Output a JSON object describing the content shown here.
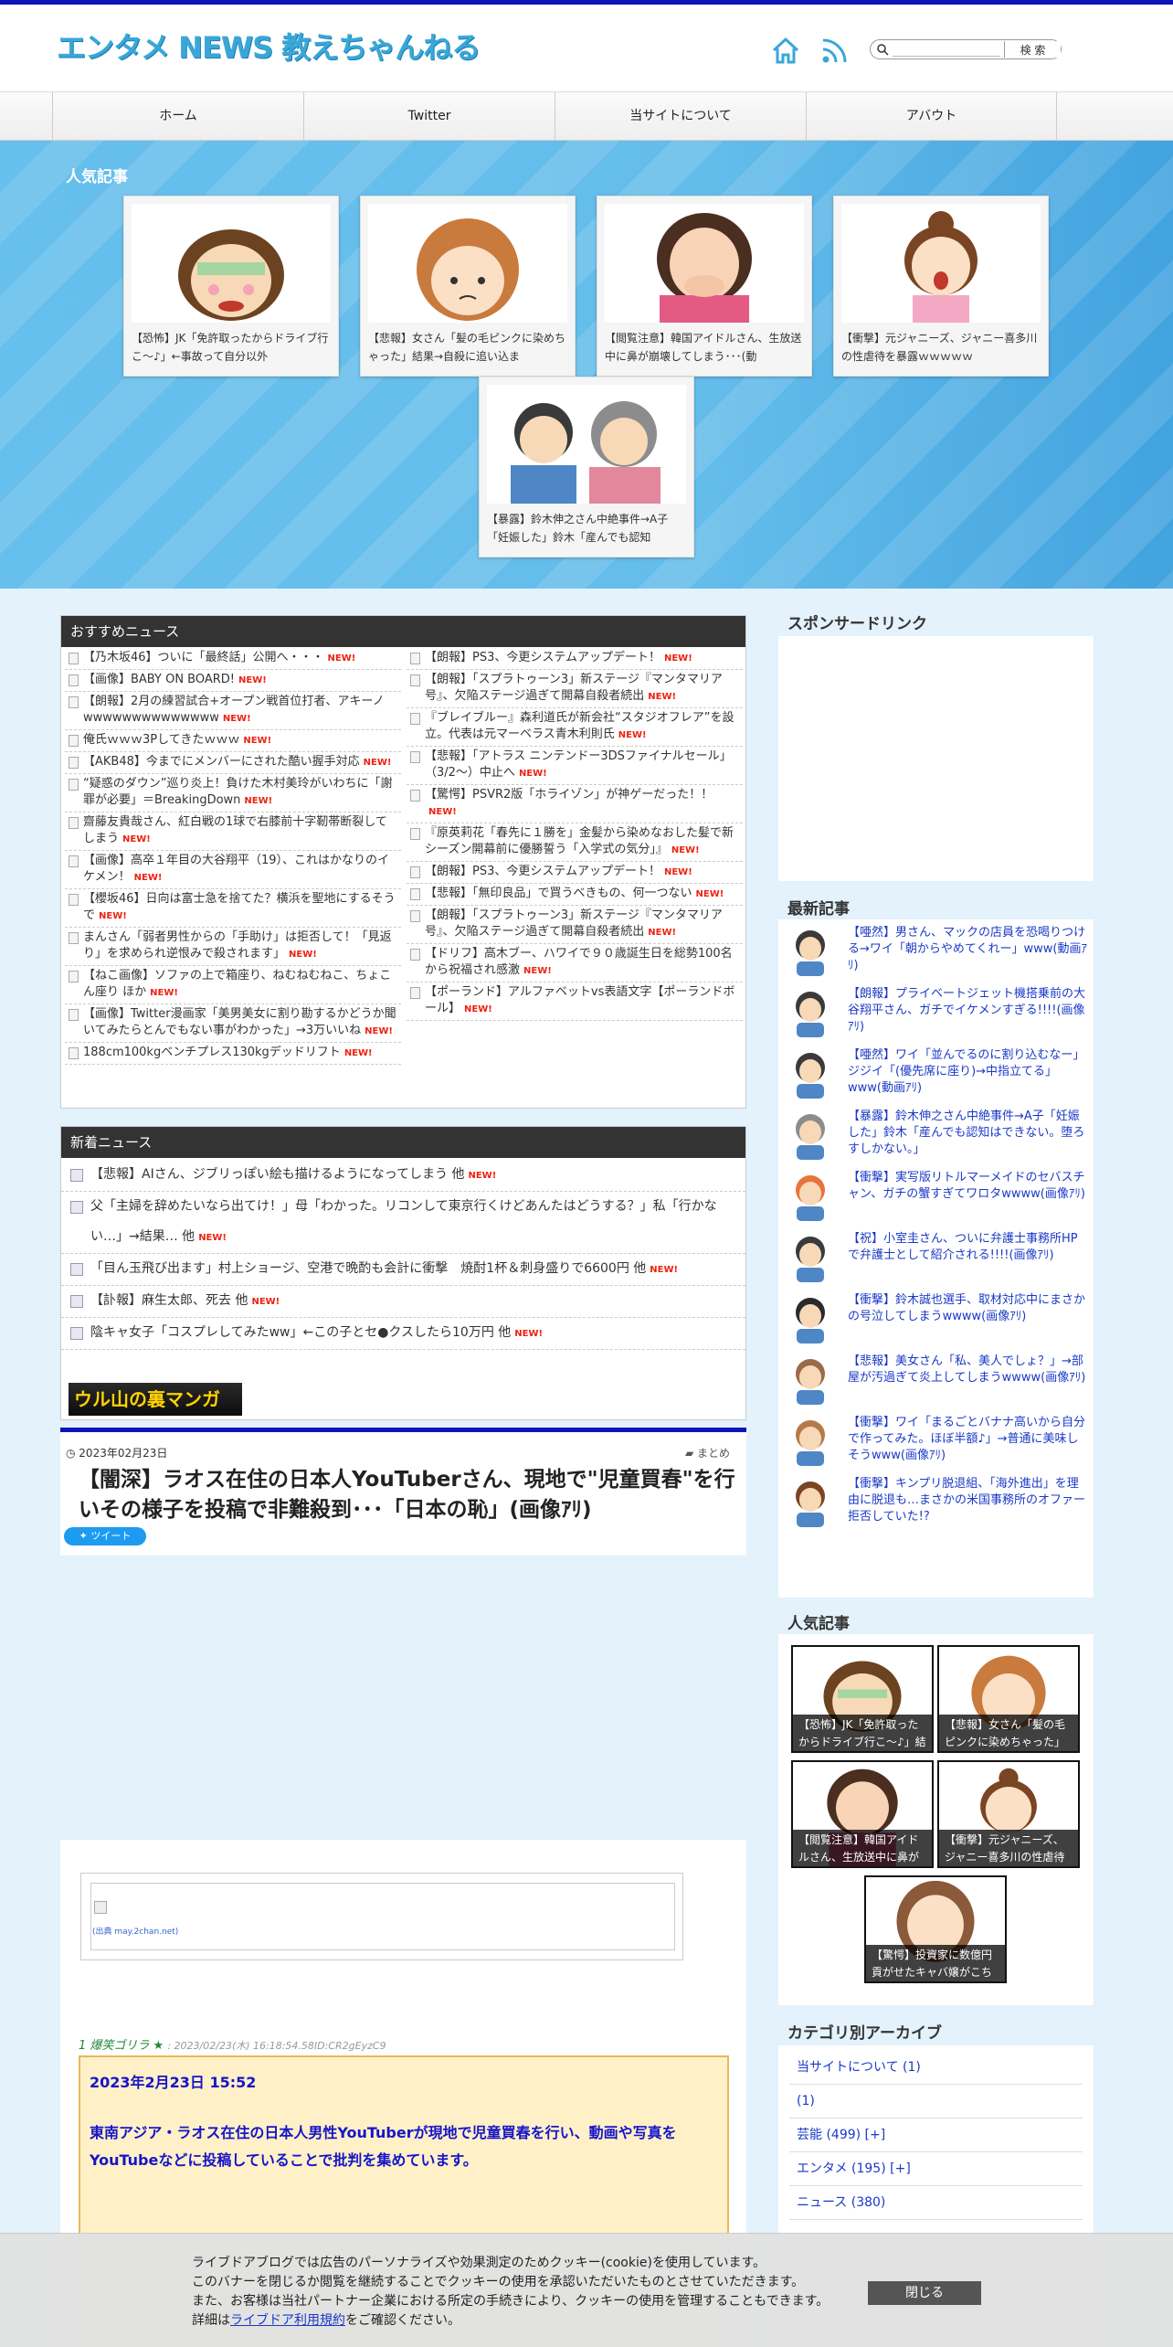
{
  "site": {
    "logo": "エンタメ NEWS 教えちゃんねる",
    "accent": "#0d14b8",
    "hero_blue": "#4ab1e6"
  },
  "header": {
    "home_icon": "home-icon",
    "rss_icon": "rss-icon",
    "search_placeholder": "",
    "search_button": "検 索"
  },
  "nav": {
    "items": [
      "ホーム",
      "Twitter",
      "当サイトについて",
      "アバウト"
    ]
  },
  "popular_hero": {
    "title": "人気記事",
    "cards": [
      "【恐怖】JK「免許取ったからドライブ行こ〜♪」←事故って自分以外",
      "【悲報】女さん「髪の毛ピンクに染めちゃった」結果→自殺に追い込ま",
      "【閲覧注意】韓国アイドルさん、生放送中に鼻が崩壊してしまう･･･(動",
      "【衝撃】元ジャニーズ、ジャニー喜多川の性虐待を暴露ｗｗｗｗｗ",
      "【暴露】鈴木伸之さん中絶事件→A子「妊娠した」鈴木「産んでも認知"
    ]
  },
  "recommended": {
    "title": "おすすめニュース",
    "new_label": "NEW!",
    "left": [
      "【乃木坂46】ついに「最終話」公開へ・・・",
      "【画像】BABY ON BOARD!",
      "【朗報】2月の練習試合+オープン戦首位打者、アキーノwwwwwwwwwwwwww",
      "俺氏ｗｗｗ3Pしてきたｗｗｗ",
      "【AKB48】今までにメンバーにされた酷い握手対応",
      "“疑惑のダウン”巡り炎上！負けた木村美玲がいわちに「謝罪が必要」＝BreakingDown",
      "齋藤友貴哉さん、紅白戦の1球で右膝前十字靭帯断裂してしまう",
      "【画像】高卒１年目の大谷翔平（19）、これはかなりのイケメン！",
      "【櫻坂46】日向は富士急を捨てた？横浜を聖地にするそうで",
      "まんさん「弱者男性からの「手助け」は拒否して！「見返り」を求められ逆恨みで殺されます」",
      "【ねこ画像】ソファの上で箱座り、ねむねむねこ、ちょこん座り ほか",
      "【画像】Twitter漫画家「美男美女に割り勘するかどうか聞いてみたらとんでもない事がわかった」→3万いいね",
      "188cm100kgベンチプレス130kgデッドリフト"
    ],
    "right": [
      "【朗報】PS3、今更システムアップデート！",
      "【朗報】「スプラトゥーン3」新ステージ『マンタマリア号』、欠陥ステージ過ぎて開幕自殺者続出",
      "『ブレイブルー』森利道氏が新会社“スタジオフレア”を設立。代表は元マーベラス青木利則氏",
      "【悲報】「アトラス ニンテンドー3DSファイナルセール」（3/2～）中止へ",
      "【驚愕】PSVR2版「ホライゾン」が神ゲーだった！！",
      "『原英莉花「春先に１勝を」金髪から染めなおした髪で新シーズン開幕前に優勝誓う「入学式の気分」』",
      "【朗報】PS3、今更システムアップデート！",
      "【悲報】「無印良品」で買うべきもの、何一つない",
      "【朗報】「スプラトゥーン3」新ステージ『マンタマリア号』、欠陥ステージ過ぎて開幕自殺者続出",
      "【ドリフ】高木ブー、ハワイで９０歳誕生日を総勢100名から祝福され感激",
      "【ポーランド】アルファベットvs表語文字【ポーランドボール】"
    ]
  },
  "latest_news": {
    "title": "新着ニュース",
    "items": [
      "【悲報】AIさん、ジブリっぽい絵も描けるようになってしまう 他",
      "父「主婦を辞めたいなら出てけ！」母「わかった。リコンして東京行くけどあんたはどうする？」私「行かない…」→結果… 他",
      "「目ん玉飛び出ます」村上ショージ、空港で晩酌も会計に衝撃　焼酎1杯＆刺身盛りで6600円 他",
      "【訃報】麻生太郎、死去 他",
      "陰キャ女子「コスプレしてみたww」←この子とセ●クスしたら10万円 他"
    ],
    "banner": "ウル山の裏マンガ"
  },
  "article": {
    "date": "2023年02月23日",
    "category": "まとめ",
    "title": "【闇深】ラオス在住の日本人YouTuberさん、現地で\"児童買春\"を行いその様子を投稿で非難殺到･･･「日本の恥」(画像ｱﾘ)",
    "tweet": "ツイート",
    "image_source": "(出典 may.2chan.net)",
    "post_author": "1 爆笑ゴリラ ★",
    "post_meta": ": 2023/02/23(木) 16:18:54.58ID:CR2gEyzC9",
    "quote_date": "2023年2月23日 15:52",
    "quote_text": "東南アジア・ラオス在住の日本人男性YouTuberが現地で児童買春を行い、動画や写真をYouTubeなどに投稿していることで批判を集めています。"
  },
  "sidebar": {
    "sponsor_title": "スポンサードリンク",
    "latest_title": "最新記事",
    "latest": [
      "【唖然】男さん、マックの店員を恐喝りつける→ワイ「朝からやめてくれー」www(動画ｱﾘ)",
      "【朗報】プライベートジェット機搭乗前の大谷翔平さん、ガチでイケメンすぎる!!!!(画像ｱﾘ)",
      "【唖然】ワイ「並んでるのに割り込むなー」ジジイ「(優先席に座り)→中指立てる」www(動画ｱﾘ)",
      "【暴露】鈴木伸之さん中絶事件→A子「妊娠した」鈴木「産んでも認知はできない。堕ろすしかない。」",
      "【衝撃】実写版リトルマーメイドのセバスチャン、ガチの蟹すぎてワロタwwww(画像ｱﾘ)",
      "【祝】小室圭さん、ついに弁護士事務所HPで弁護士として紹介される!!!!(画像ｱﾘ)",
      "【衝撃】鈴木誠也選手、取材対応中にまさかの号泣してしまうwwww(画像ｱﾘ)",
      "【悲報】美女さん「私、美人でしょ？」→部屋が汚過ぎて炎上してしまうwwww(画像ｱﾘ)",
      "【衝撃】ワイ「まるごとバナナ高いから自分で作ってみた。ほぼ半額♪」→普通に美味しそうwww(画像ｱﾘ)",
      "【衝撃】キンプリ脱退組、「海外進出」を理由に脱退も…まさかの米国事務所のオファー拒否していた!?"
    ],
    "popular_title": "人気記事",
    "popular": [
      "【恐怖】JK「免許取ったからドライブ行こ〜♪」結果",
      "【悲報】女さん「髪の毛ピンクに染めちゃった」結果",
      "【閲覧注意】韓国アイドルさん、生放送中に鼻が崩壊",
      "【衝撃】元ジャニーズ、ジャニー喜多川の性虐待を暴",
      "【驚愕】投資家に数億円貢がせたキャバ嬢がこちら"
    ],
    "archive_title": "カテゴリ別アーカイブ",
    "archive": [
      "当サイトについて (1)",
      "(1)",
      "芸能 (499) [+]",
      "エンタメ (195) [+]",
      "ニュース (380)"
    ]
  },
  "cookie": {
    "line1": "ライブドアブログでは広告のパーソナライズや効果測定のためクッキー(cookie)を使用しています。",
    "line2": "このバナーを閉じるか閲覧を継続することでクッキーの使用を承認いただいたものとさせていただきます。",
    "line3": "また、お客様は当社パートナー企業における所定の手続きにより、クッキーの使用を管理することもできます。",
    "line4_pre": "詳細は",
    "link": "ライブドア利用規約",
    "line4_post": "をご確認ください。",
    "close": "閉じる"
  }
}
